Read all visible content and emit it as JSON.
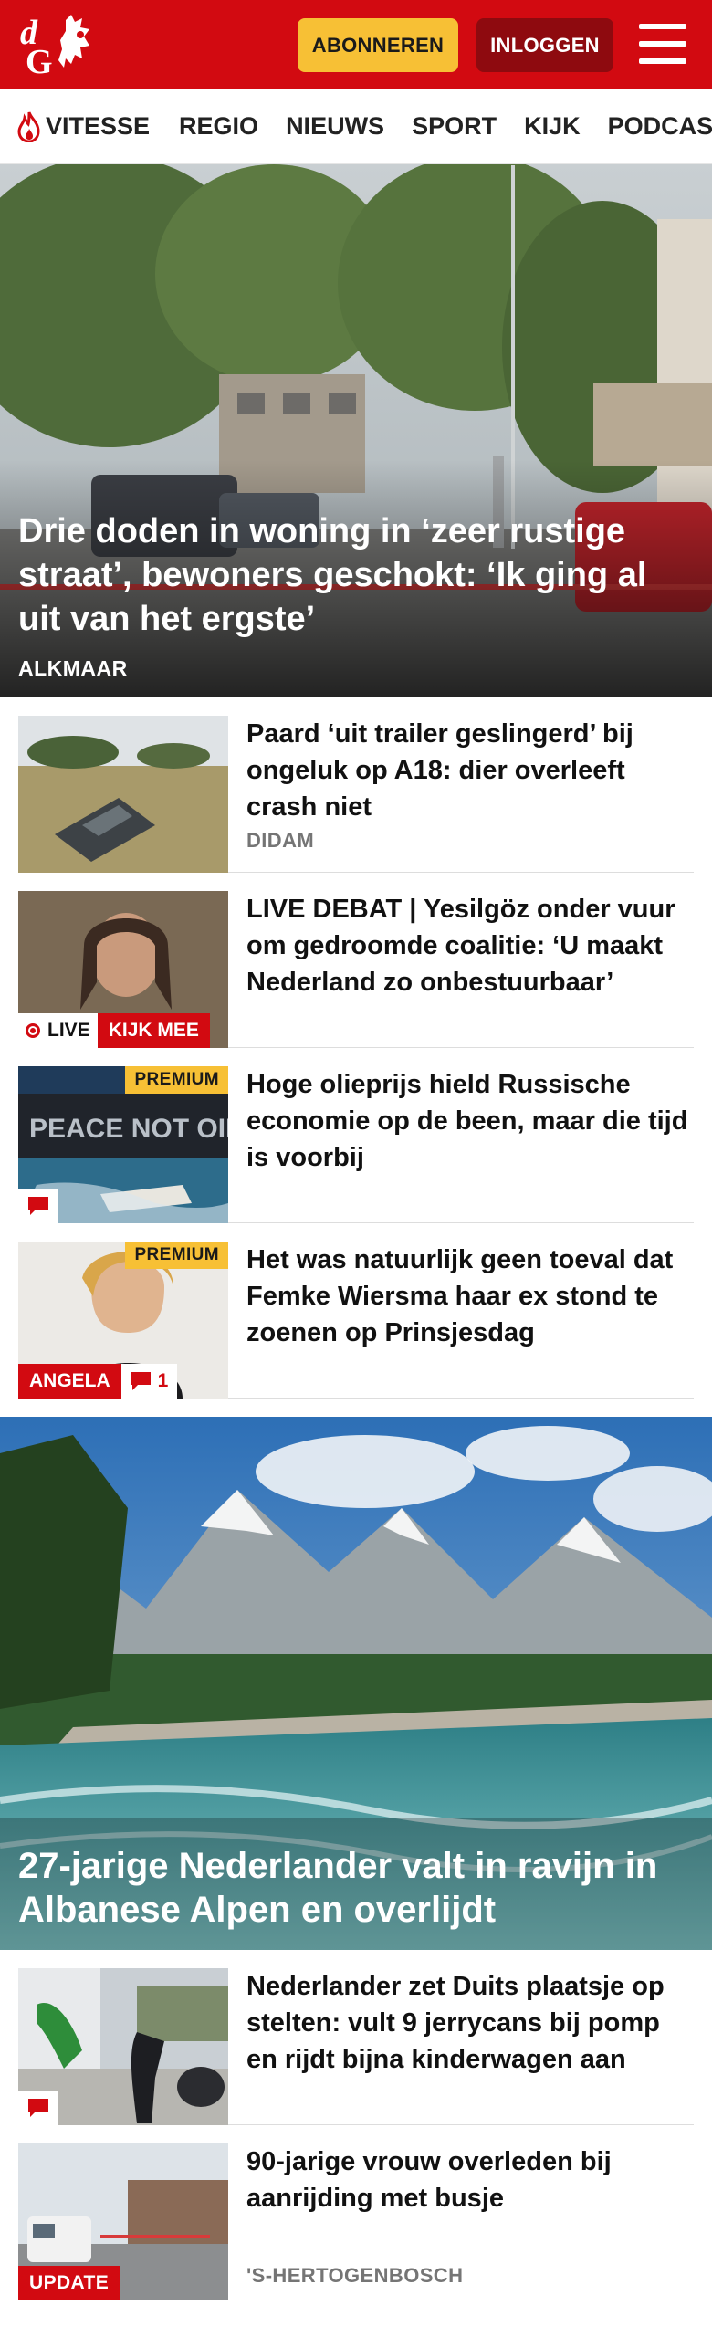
{
  "header": {
    "subscribe_label": "ABONNEREN",
    "login_label": "INLOGGEN",
    "brand_color": "#d20a11",
    "accent_color": "#f7c035",
    "logo_icon": "dg-logo-icon",
    "menu_icon": "hamburger-menu-icon"
  },
  "nav": {
    "items": [
      {
        "label": "VITESSE",
        "icon": "flame-icon"
      },
      {
        "label": "REGIO"
      },
      {
        "label": "NIEUWS"
      },
      {
        "label": "SPORT"
      },
      {
        "label": "KIJK"
      },
      {
        "label": "PODCAST"
      }
    ]
  },
  "hero": {
    "title": "Drie doden in woning in ‘zeer rustige straat’, bewoners geschokt: ‘Ik ging al uit van het ergste’",
    "location": "ALKMAAR"
  },
  "articles": [
    {
      "title": "Paard ‘uit trailer geslingerd’ bij ongeluk op A18: dier overleeft crash niet",
      "location": "DIDAM"
    },
    {
      "title": "LIVE DEBAT | Yesilgöz onder vuur om gedroomde coalitie: ‘U maakt Nederland zo onbestuurbaar’",
      "live_label": "LIVE",
      "watch_label": "KIJK MEE"
    },
    {
      "title": "Hoge olieprijs hield Russische economie op de been, maar die tijd is voorbij",
      "premium_label": "PREMIUM",
      "thumb_text": "PEACE NOT OIL"
    },
    {
      "title": "Het was natuurlijk geen toeval dat Femke Wiersma haar ex stond te zoenen op Prinsjesdag",
      "premium_label": "PREMIUM",
      "author_label": "ANGELA",
      "comment_count": "1"
    }
  ],
  "hero2": {
    "title": "27-jarige Nederlander valt in ravijn in Albanese Alpen en overlijdt"
  },
  "articles2": [
    {
      "title": "Nederlander zet Duits plaatsje op stelten: vult 9 jerrycans bij pomp en rijdt bijna kinderwagen aan"
    },
    {
      "title": "90-jarige vrouw overleden bij aanrijding met busje",
      "update_label": "UPDATE",
      "location": "'S-HERTOGENBOSCH"
    }
  ]
}
